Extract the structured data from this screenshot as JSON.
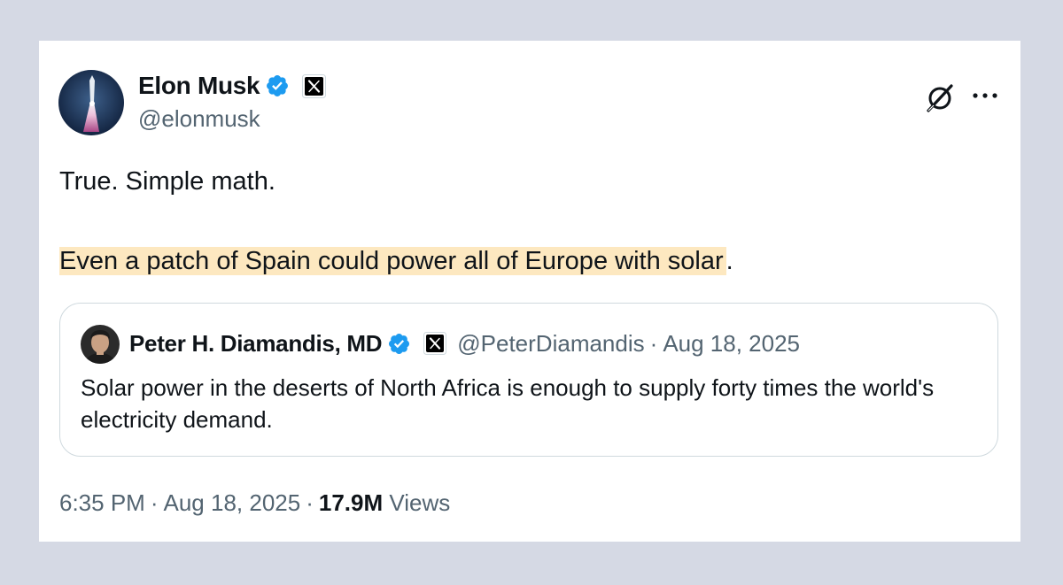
{
  "colors": {
    "page_background": "#d5d9e4",
    "card_background": "#ffffff",
    "verified_blue": "#1d9bf0",
    "muted_text": "#536471",
    "highlight": "#fde8c0",
    "quote_border": "#cfd9de"
  },
  "author": {
    "display_name": "Elon Musk",
    "handle": "@elonmusk",
    "verified_icon": "verified-badge-icon",
    "affiliation_icon": "x-logo-icon",
    "avatar": "rocket-launch-avatar"
  },
  "actions": {
    "grok_icon": "grok-icon",
    "more_icon": "more-dots-icon"
  },
  "tweet": {
    "line1": "True. Simple math.",
    "line2_highlighted": "Even a patch of Spain could power all of Europe with solar",
    "line2_tail": "."
  },
  "quote": {
    "display_name": "Peter H. Diamandis, MD",
    "handle": "@PeterDiamandis",
    "separator": "·",
    "date": "Aug 18, 2025",
    "text": "Solar power in the deserts of North Africa is enough to supply forty times the world's electricity demand.",
    "avatar": "portrait-avatar"
  },
  "meta": {
    "time": "6:35 PM",
    "sep1": "·",
    "date": "Aug 18, 2025",
    "sep2": "·",
    "views_count": "17.9M",
    "views_label": "Views"
  }
}
